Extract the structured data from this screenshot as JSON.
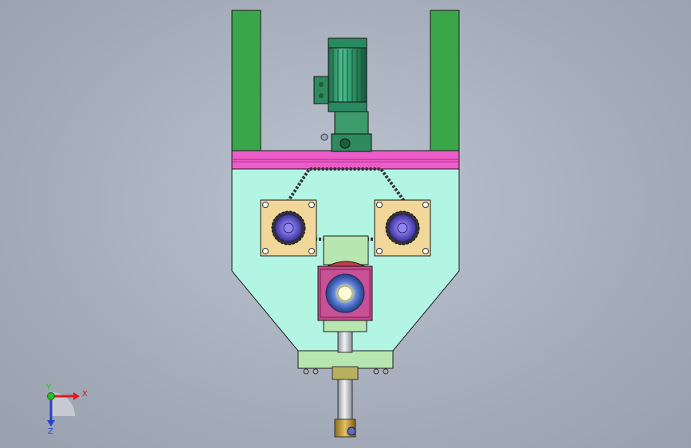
{
  "triad": {
    "x_label": "X",
    "y_label": "Y",
    "z_label": "Z"
  },
  "colors": {
    "background": "#a9b1bf",
    "frame_green": "#3aa64a",
    "motor_green": "#2f9a6e",
    "plate_magenta": "#ee5cc9",
    "hopper_mint": "#b2f5e2",
    "bearing_plate": "#f1d79a",
    "sprocket_blue": "#7a6ee0",
    "gearbox_pink": "#c54a8a",
    "shaft_gray": "#c9ccd3",
    "collar_gold": "#c9a23a",
    "base_green": "#b8e6b0",
    "chain_dark": "#333333"
  },
  "icons": {
    "triad": "xyz-coordinate-triad-icon",
    "motor": "electric-motor-icon",
    "sprocket": "sprocket-icon",
    "gearbox": "gearbox-icon"
  }
}
